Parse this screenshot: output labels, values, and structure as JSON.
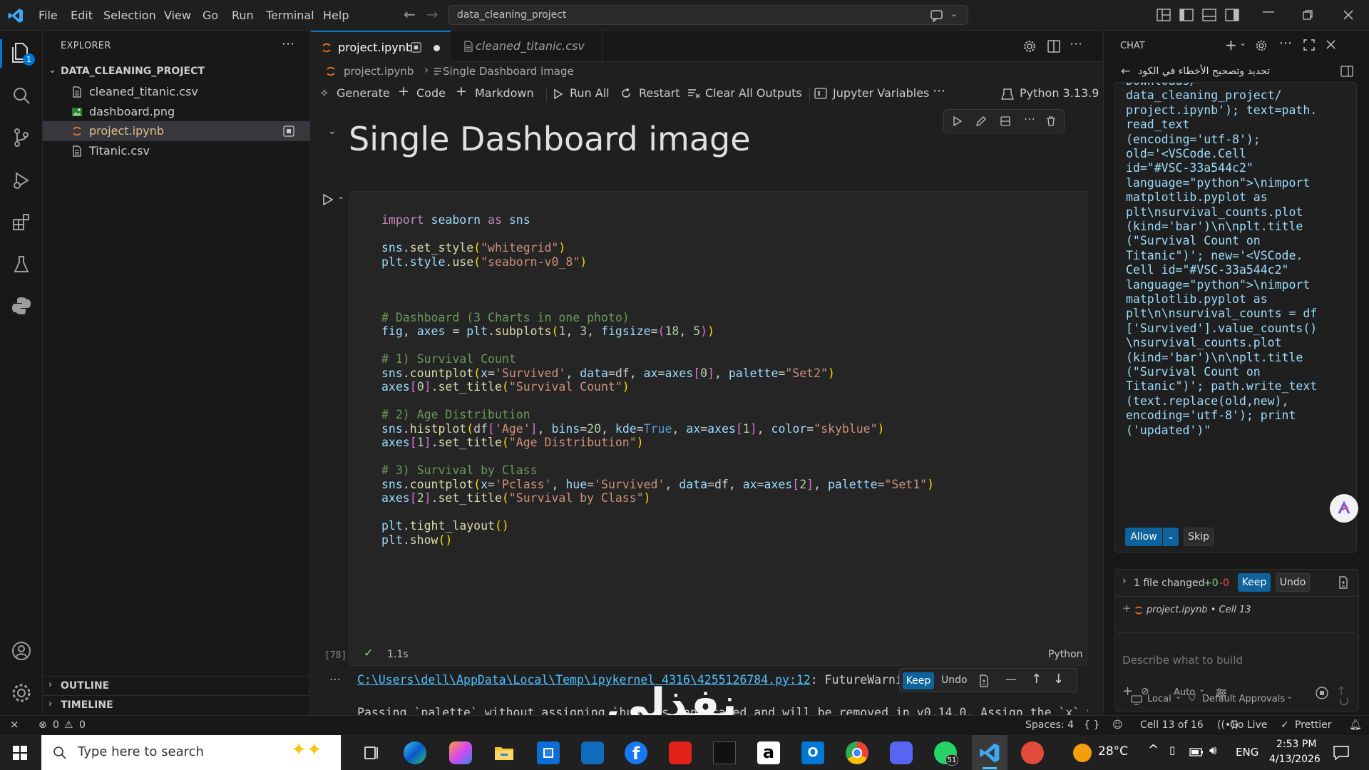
{
  "titlebar": {
    "menus": [
      "File",
      "Edit",
      "Selection",
      "View",
      "Go",
      "Run",
      "Terminal",
      "Help"
    ],
    "search": "data_cleaning_project"
  },
  "activity": {
    "explorer_badge": "1"
  },
  "explorer": {
    "title": "EXPLORER",
    "project": "DATA_CLEANING_PROJECT",
    "files": [
      "cleaned_titanic.csv",
      "dashboard.png",
      "project.ipynb",
      "Titanic.csv"
    ],
    "outline": "OUTLINE",
    "timeline": "TIMELINE"
  },
  "tabs": {
    "active": "project.ipynb",
    "second": "cleaned_titanic.csv"
  },
  "breadcrumb": {
    "file": "project.ipynb",
    "cell": "Single Dashboard image"
  },
  "toolbar": {
    "generate": "Generate",
    "code": "Code",
    "markdown": "Markdown",
    "run_all": "Run All",
    "restart": "Restart",
    "clear": "Clear All Outputs",
    "variables": "Jupyter Variables",
    "kernel": "Python 3.13.9"
  },
  "markdown_heading": "Single Dashboard image",
  "code_lines": [
    "import seaborn as sns",
    "",
    "sns.set_style(\"whitegrid\")",
    "plt.style.use(\"seaborn-v0_8\")",
    "",
    "",
    "",
    "# Dashboard (3 Charts in one photo)",
    "fig, axes = plt.subplots(1, 3, figsize=(18, 5))",
    "",
    "# 1) Survival Count",
    "sns.countplot(x='Survived', data=df, ax=axes[0], palette=\"Set2\")",
    "axes[0].set_title(\"Survival Count\")",
    "",
    "# 2) Age Distribution",
    "sns.histplot(df['Age'], bins=20, kde=True, ax=axes[1], color=\"skyblue\")",
    "axes[1].set_title(\"Age Distribution\")",
    "",
    "# 3) Survival by Class",
    "sns.countplot(x='Pclass', hue='Survived', data=df, ax=axes[2], palette=\"Set1\")",
    "axes[2].set_title(\"Survival by Class\")",
    "",
    "plt.tight_layout()",
    "plt.show()"
  ],
  "cell_status": {
    "exec_count": "[78]",
    "time": "1.1s",
    "language": "Python"
  },
  "output": {
    "path": "C:\\Users\\dell\\AppData\\Local\\Temp\\ipykernel_4316\\4255126784.py:12",
    "warning": ": FutureWarning",
    "second": "Passing `palette` without assigning `hue` is deprecated and will be removed in v0.14.0. Assign the `x` var",
    "keep": "Keep",
    "undo": "Undo"
  },
  "chat": {
    "title": "CHAT",
    "session": "تحديد وتصحيح الأخطاء في الكود",
    "code": [
      "Downloads/",
      "data_cleaning_project/",
      "project.ipynb'); text=path.",
      "read_text",
      "(encoding='utf-8');",
      "old='<VSCode.Cell",
      "id=\"#VSC-33a544c2\"",
      "language=\"python\">\\nimport",
      "matplotlib.pyplot as",
      "plt\\nsurvival_counts.plot",
      "(kind='bar')\\n\\nplt.title",
      "(\"Survival Count on",
      "Titanic\")'; new='<VSCode.",
      "Cell id=\"#VSC-33a544c2\"",
      "language=\"python\">\\nimport",
      "matplotlib.pyplot as",
      "plt\\n\\nsurvival_counts = df",
      "['Survived'].value_counts()",
      "\\nsurvival_counts.plot",
      "(kind='bar')\\n\\nplt.title",
      "(\"Survival Count on",
      "Titanic\")'; path.write_text",
      "(text.replace(old,new),",
      "encoding='utf-8'); print",
      "('updated')\""
    ],
    "allow": "Allow",
    "skip": "Skip",
    "files_changed": "1 file changed",
    "added": "+0",
    "removed": "-0",
    "keep": "Keep",
    "undo": "Undo",
    "context_file": "project.ipynb • Cell 13",
    "placeholder": "Describe what to build",
    "mode": "Auto",
    "location": "Local",
    "approvals": "Default Approvals"
  },
  "watermark": "نفذلي",
  "statusbar": {
    "errors": "0",
    "warnings": "0",
    "spaces": "Spaces: 4",
    "braces": "{ }",
    "cell": "Cell 13 of 16",
    "golive": "Go Live",
    "prettier": "Prettier"
  },
  "taskbar": {
    "search": "Type here to search",
    "temperature": "28°C",
    "lang": "ENG",
    "time": "2:53 PM",
    "date": "4/13/2026",
    "whatsapp_badge": "51"
  }
}
